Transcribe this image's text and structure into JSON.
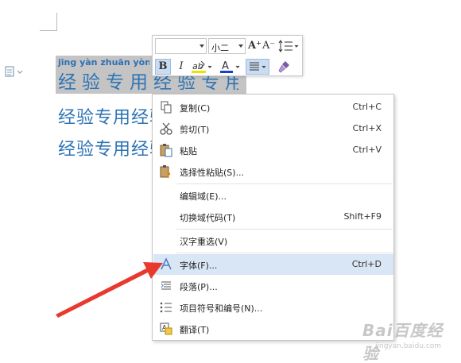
{
  "document": {
    "pinyin_line": "jīng yàn zhuān yòng jīng",
    "line1_text": "经验专用经验专用",
    "line2_text": "经验专用经验专用",
    "line3_text": "经验专用经验专用"
  },
  "mini_toolbar": {
    "font_name": "",
    "font_size": "小二",
    "grow_font": "A⁺",
    "shrink_font": "A⁻",
    "bold": "B",
    "italic": "I",
    "highlight_color": "#f2e100",
    "font_color": "#1a3fcf"
  },
  "context_menu": {
    "items": [
      {
        "label": "复制(C)",
        "shortcut": "Ctrl+C",
        "icon": "copy-icon"
      },
      {
        "label": "剪切(T)",
        "shortcut": "Ctrl+X",
        "icon": "cut-icon"
      },
      {
        "label": "粘贴",
        "shortcut": "Ctrl+V",
        "icon": "paste-icon"
      },
      {
        "label": "选择性粘贴(S)...",
        "shortcut": "",
        "icon": "paste-special-icon"
      },
      {
        "label": "编辑域(E)...",
        "shortcut": "",
        "icon": ""
      },
      {
        "label": "切换域代码(T)",
        "shortcut": "Shift+F9",
        "icon": ""
      },
      {
        "label": "汉字重选(V)",
        "shortcut": "",
        "icon": ""
      },
      {
        "label": "字体(F)...",
        "shortcut": "Ctrl+D",
        "icon": "font-icon"
      },
      {
        "label": "段落(P)...",
        "shortcut": "",
        "icon": "paragraph-icon"
      },
      {
        "label": "项目符号和编号(N)...",
        "shortcut": "",
        "icon": "bullets-icon"
      },
      {
        "label": "翻译(T)",
        "shortcut": "",
        "icon": "translate-icon"
      }
    ],
    "hovered_index": 7
  },
  "watermark": {
    "text": "Bai百度经验",
    "sub": "jingyan.baidu.com"
  },
  "colors": {
    "doc_text": "#2e74b5",
    "selection": "#c4c4c4",
    "menu_hover": "#d8e6f6",
    "arrow": "#e8392f"
  }
}
